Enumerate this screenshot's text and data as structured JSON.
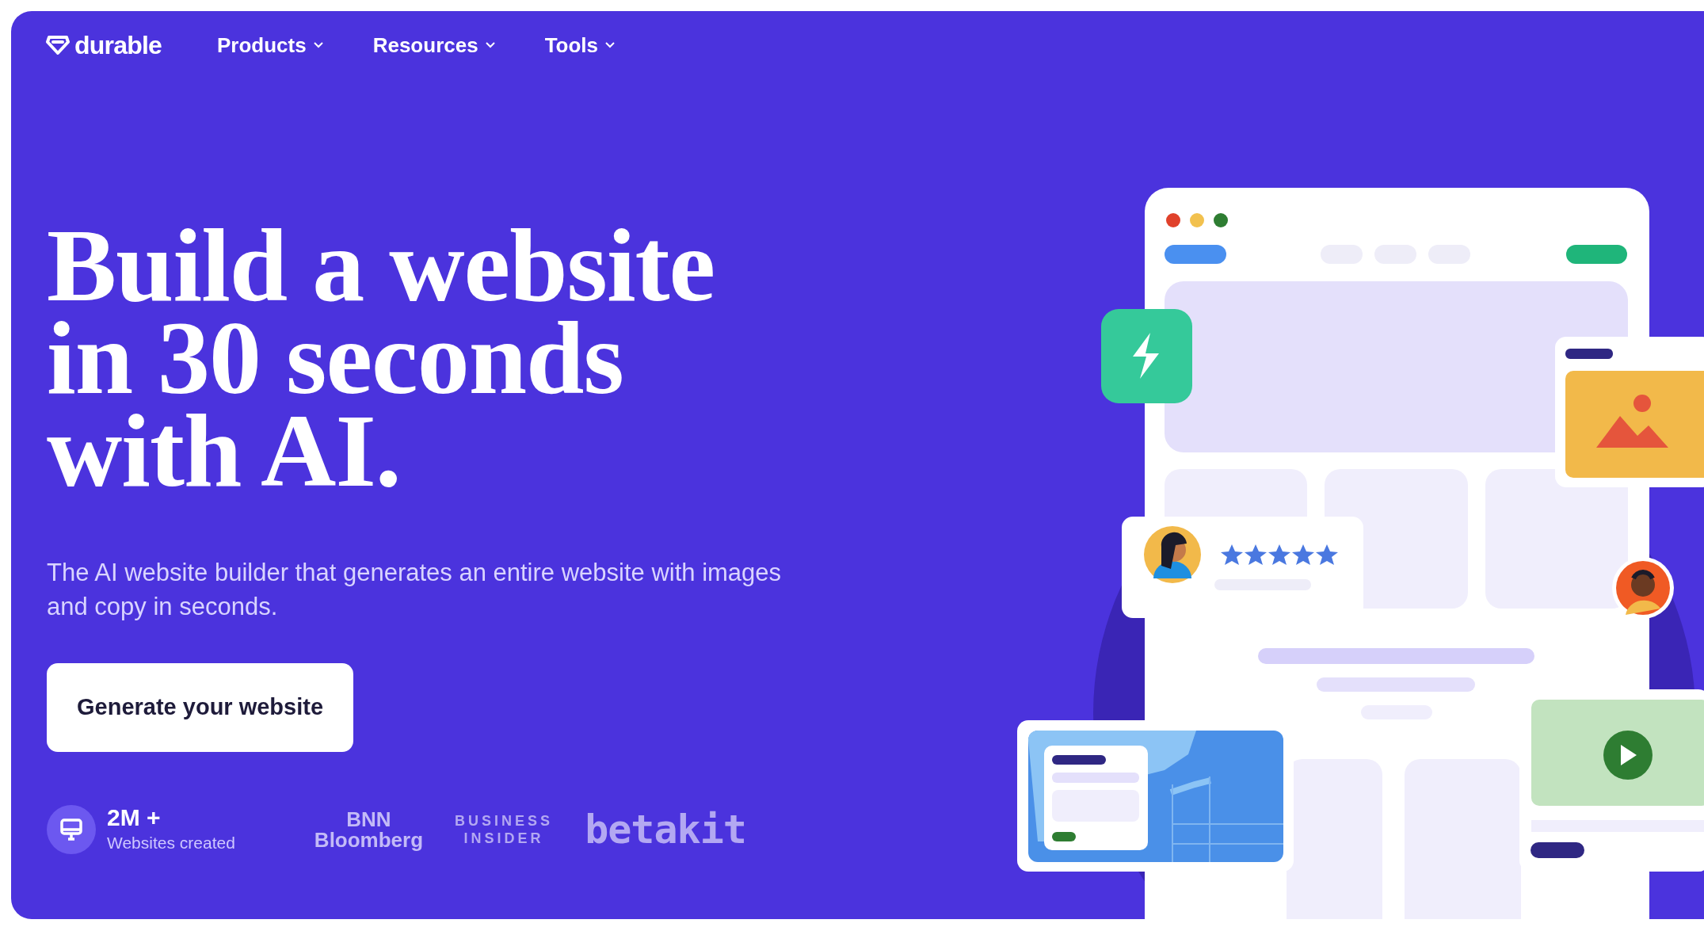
{
  "nav": {
    "logo": "durable",
    "items": [
      {
        "label": "Products",
        "has_menu": true
      },
      {
        "label": "Resources",
        "has_menu": true
      },
      {
        "label": "Tools",
        "has_menu": true
      }
    ]
  },
  "hero": {
    "headline": [
      "Build a website",
      "in 30 seconds",
      "with AI."
    ],
    "subtitle": "The AI website builder that generates an entire website with images and copy in seconds.",
    "cta": "Generate your website"
  },
  "stat": {
    "value": "2M +",
    "label": "Websites created"
  },
  "press_logos": [
    {
      "kind": "stacked",
      "lines": [
        "BNN",
        "Bloomberg"
      ]
    },
    {
      "kind": "spaced",
      "lines": [
        "BUSINESS",
        "INSIDER"
      ]
    },
    {
      "kind": "heavy",
      "lines": [
        "betakit"
      ]
    }
  ]
}
